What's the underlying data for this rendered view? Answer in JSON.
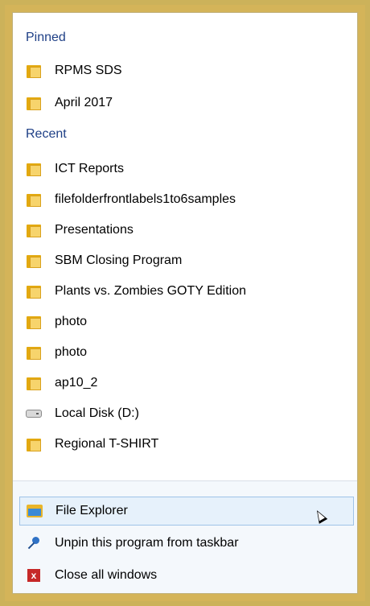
{
  "sections": {
    "pinned_label": "Pinned",
    "recent_label": "Recent"
  },
  "pinned": [
    {
      "label": "RPMS SDS",
      "icon": "folder-icon"
    },
    {
      "label": "April 2017",
      "icon": "folder-icon"
    }
  ],
  "recent": [
    {
      "label": "ICT Reports",
      "icon": "folder-icon"
    },
    {
      "label": "filefolderfrontlabels1to6samples",
      "icon": "folder-icon"
    },
    {
      "label": "Presentations",
      "icon": "folder-icon"
    },
    {
      "label": "SBM Closing Program",
      "icon": "folder-icon"
    },
    {
      "label": "Plants vs. Zombies GOTY Edition",
      "icon": "folder-icon"
    },
    {
      "label": "photo",
      "icon": "folder-icon"
    },
    {
      "label": "photo",
      "icon": "folder-icon"
    },
    {
      "label": "ap10_2",
      "icon": "folder-icon"
    },
    {
      "label": "Local Disk (D:)",
      "icon": "drive-icon"
    },
    {
      "label": "Regional T-SHIRT",
      "icon": "folder-icon"
    }
  ],
  "actions": {
    "file_explorer": "File Explorer",
    "unpin": "Unpin this program from taskbar",
    "close_all": "Close all windows"
  },
  "colors": {
    "frame": "#d4b459",
    "section_header": "#1e3f86",
    "highlight": "#e6f1fb"
  }
}
